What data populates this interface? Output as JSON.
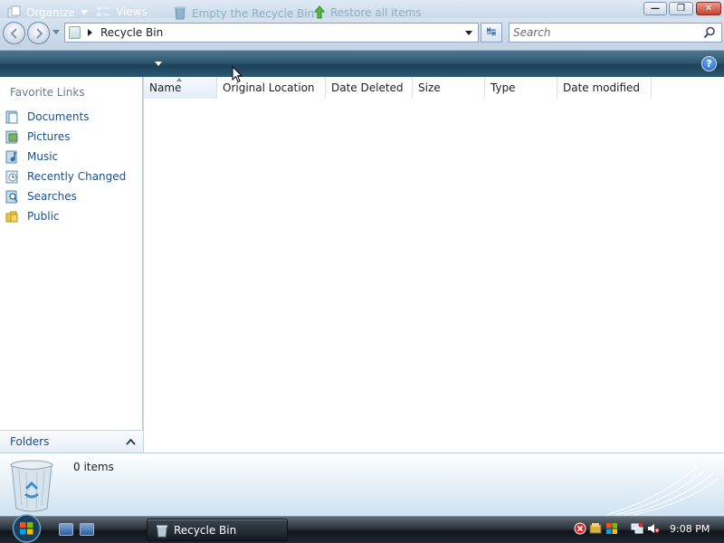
{
  "window": {
    "controls": {
      "minimize": "—",
      "maximize": "❐",
      "close": "✕"
    }
  },
  "address": {
    "location": "Recycle Bin",
    "search_placeholder": "Search",
    "refresh_symbol": "↹"
  },
  "toolbar": {
    "organize_label": "Organize",
    "views_label": "Views",
    "empty_bin_label": "Empty the Recycle Bin",
    "restore_label": "Restore all items",
    "help_label": "?"
  },
  "nav": {
    "favorites_title": "Favorite Links",
    "items": [
      {
        "label": "Documents",
        "icon": "documents-icon"
      },
      {
        "label": "Pictures",
        "icon": "pictures-icon"
      },
      {
        "label": "Music",
        "icon": "music-icon"
      },
      {
        "label": "Recently Changed",
        "icon": "recently-changed-icon"
      },
      {
        "label": "Searches",
        "icon": "searches-icon"
      },
      {
        "label": "Public",
        "icon": "public-folder-icon"
      }
    ],
    "folders_label": "Folders"
  },
  "columns": [
    "Name",
    "Original Location",
    "Date Deleted",
    "Size",
    "Type",
    "Date modified"
  ],
  "details": {
    "item_count": "0 items"
  },
  "taskbar": {
    "task_label": "Recycle Bin",
    "clock": "9:08 PM"
  },
  "colors": {
    "command_bar": "#2f5870",
    "link_text": "#1b4f8e",
    "taskbar": "#1f282f"
  }
}
